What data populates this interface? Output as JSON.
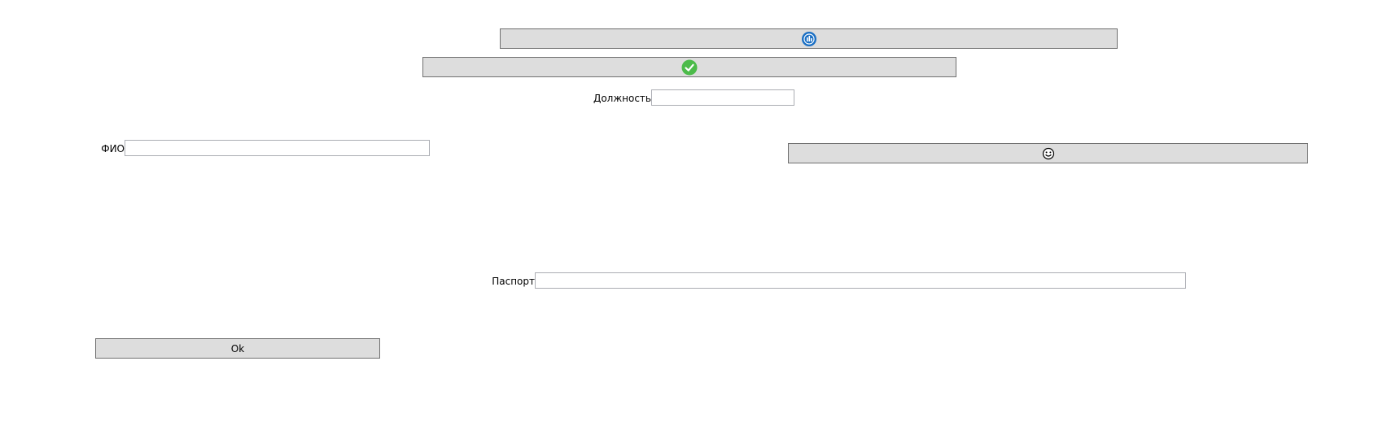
{
  "buttons": {
    "top_icon_button": {
      "icon": "blue-circle-logo-icon",
      "label": ""
    },
    "confirm_button": {
      "icon": "green-check-icon",
      "label": ""
    },
    "right_icon_button": {
      "icon": "smiley-face-icon",
      "label": ""
    },
    "ok_button": {
      "label": "Ok"
    }
  },
  "fields": {
    "position": {
      "label": "Должность",
      "value": "",
      "placeholder": ""
    },
    "fio": {
      "label": "ФИО",
      "value": "",
      "placeholder": ""
    },
    "passport": {
      "label": "Паспорт",
      "value": "",
      "placeholder": ""
    }
  },
  "colors": {
    "button_face": "#dddddd",
    "button_border": "#707070",
    "field_border": "#abadb3",
    "icon_blue": "#1a6fc4",
    "icon_green": "#4cbb4a"
  }
}
